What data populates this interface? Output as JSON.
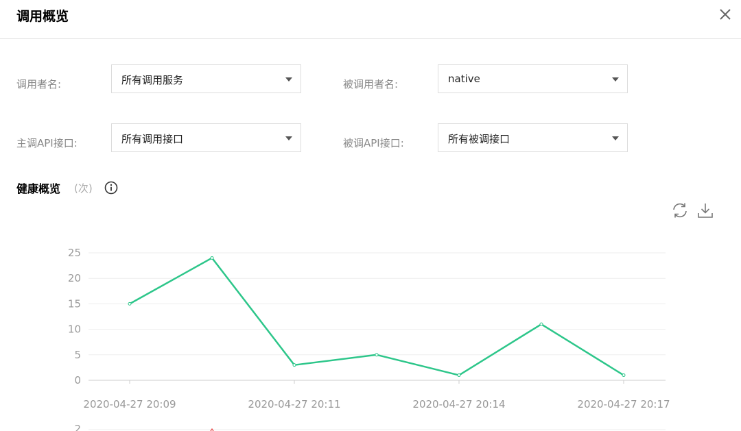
{
  "dialog": {
    "title": "调用概览"
  },
  "filters": {
    "caller_name": {
      "label": "调用者名:",
      "value": "所有调用服务"
    },
    "callee_name": {
      "label": "被调用者名:",
      "value": "native"
    },
    "caller_api": {
      "label": "主调API接口:",
      "value": "所有调用接口"
    },
    "callee_api": {
      "label": "被调API接口:",
      "value": "所有被调接口"
    }
  },
  "health": {
    "title": "健康概览",
    "unit": "(次)"
  },
  "icons": {
    "close": "close-icon",
    "info": "info-icon",
    "refresh": "refresh-icon",
    "download": "download-icon"
  },
  "colors": {
    "line": "#2dc68a",
    "second_chart_marker": "#e84a4a"
  },
  "chart_data": {
    "type": "line",
    "title": "",
    "xlabel": "",
    "ylabel": "",
    "x": [
      "20:09",
      "20:10",
      "20:11",
      "20:12",
      "20:14",
      "20:15",
      "20:17"
    ],
    "values": [
      15,
      24,
      3,
      5,
      1,
      11,
      1
    ],
    "x_tick_labels": [
      "2020-04-27 20:09",
      "2020-04-27 20:11",
      "2020-04-27 20:14",
      "2020-04-27 20:17"
    ],
    "y_ticks": [
      0,
      5,
      10,
      15,
      20,
      25
    ],
    "ylim": [
      0,
      25
    ],
    "grid": true,
    "next_chart_top_tick": "2"
  }
}
